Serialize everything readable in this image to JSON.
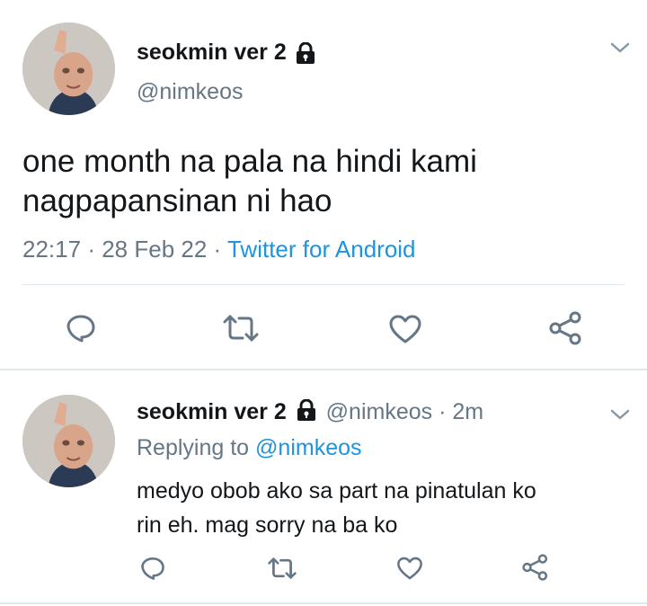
{
  "main_tweet": {
    "display_name": "seokmin ver 2",
    "handle": "@nimkeos",
    "text_line1": "one month na pala na hindi kami",
    "text_line2": "nagpapansinan ni hao",
    "time": "22:17",
    "date": "28 Feb 22",
    "source": "Twitter for Android",
    "separator": "·"
  },
  "reply_tweet": {
    "display_name": "seokmin ver 2",
    "handle": "@nimkeos",
    "age": "2m",
    "separator": "·",
    "replying_prefix": "Replying to",
    "replying_handle": "@nimkeos",
    "text_line1": "medyo obob ako sa part na pinatulan ko",
    "text_line2": "rin eh. mag sorry na ba ko"
  },
  "icons": {
    "lock": "lock-icon",
    "chevron": "chevron-down-icon",
    "reply": "reply-icon",
    "retweet": "retweet-icon",
    "like": "heart-icon",
    "share": "share-icon"
  },
  "colors": {
    "text": "#14171a",
    "muted": "#657786",
    "link": "#1b95e0",
    "divider": "#e1e8ed"
  }
}
